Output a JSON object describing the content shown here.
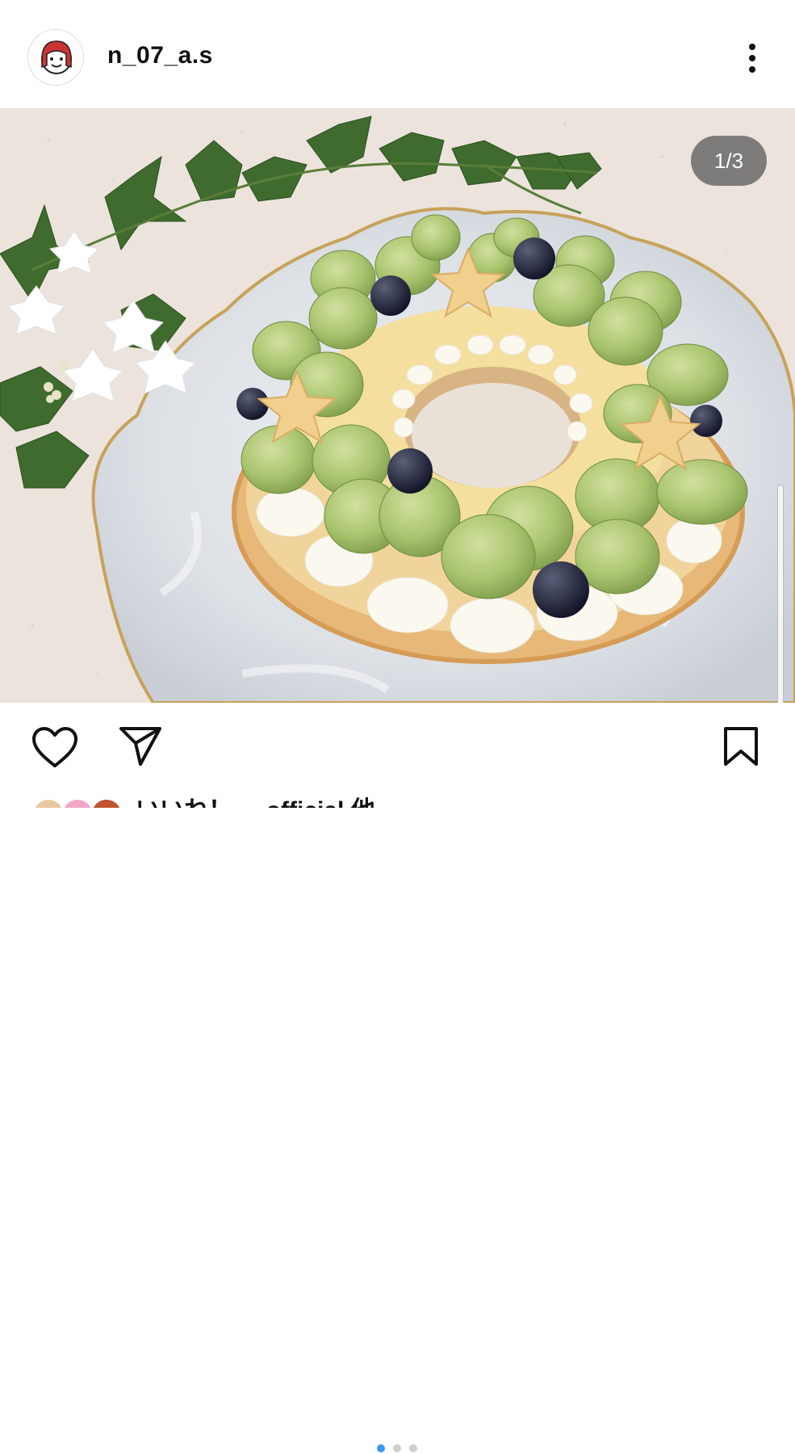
{
  "post": {
    "username": "n_07_a.s",
    "counter": "1/3",
    "current_slide": 1,
    "total_slides": 3,
    "likes_text": "いいね！ ... official 他"
  },
  "icons": {
    "more": "more-vertical-icon",
    "like": "heart-icon",
    "share": "send-icon",
    "save": "bookmark-icon"
  },
  "colors": {
    "accent_dot": "#3897f0",
    "inactive_dot": "#cfcfcf",
    "counter_bg": "#5a5a5a"
  }
}
